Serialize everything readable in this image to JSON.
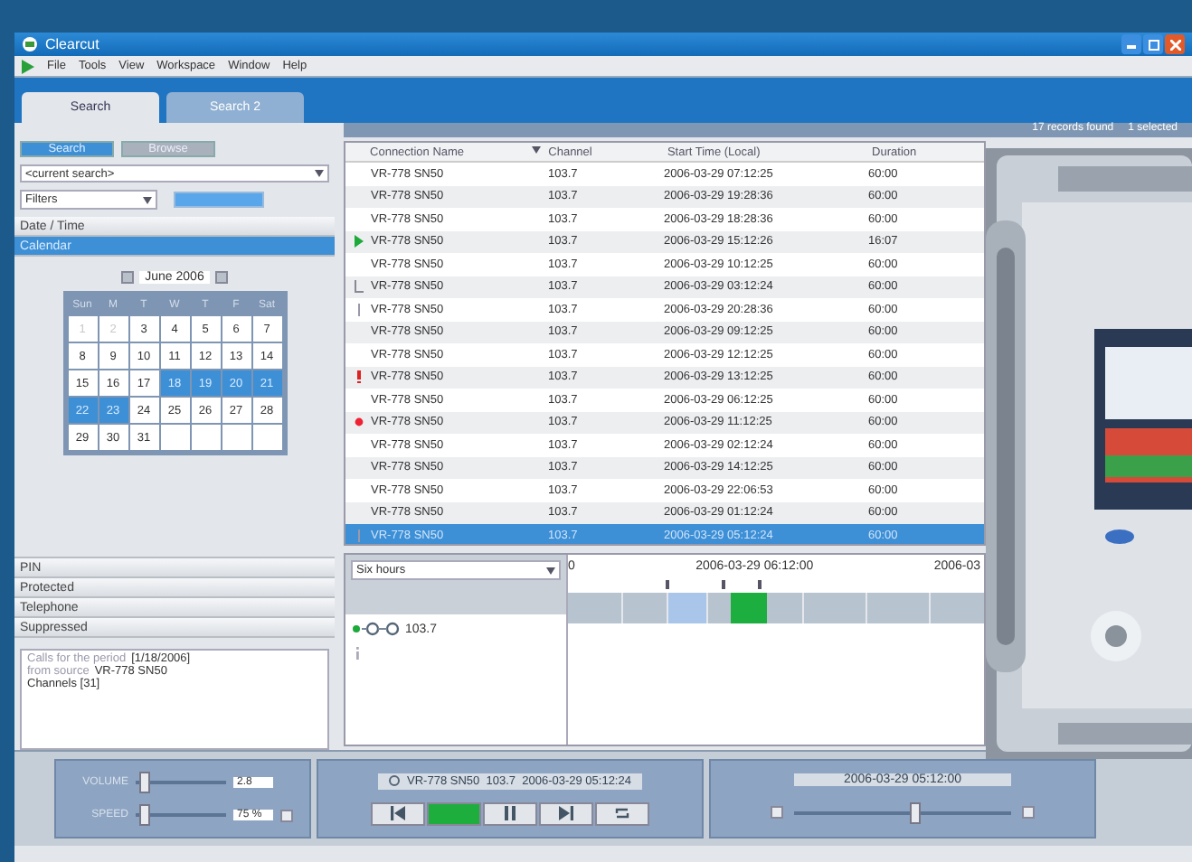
{
  "window": {
    "title": "Clearcut"
  },
  "menu": [
    "File",
    "Tools",
    "View",
    "Workspace",
    "Window",
    "Help"
  ],
  "tabs": [
    {
      "label": "Search",
      "selected": true
    },
    {
      "label": "Search 2",
      "selected": false
    }
  ],
  "left_panel": {
    "modes": [
      {
        "label": "Search",
        "selected": true
      },
      {
        "label": "Browse",
        "selected": false
      }
    ],
    "search_combo": {
      "value": "<current search>"
    },
    "filters_combo": {
      "value": "Filters"
    },
    "sections_top": [
      {
        "label": "Date / Time",
        "selected": false
      },
      {
        "label": "Calendar",
        "selected": true
      }
    ],
    "calendar": {
      "month": "June 2006",
      "weekdays": [
        "Sun",
        "M",
        "T",
        "W",
        "T",
        "F",
        "Sat"
      ],
      "days": [
        {
          "text": "1",
          "muted": true,
          "selected": false
        },
        {
          "text": "2",
          "muted": true,
          "selected": false
        },
        {
          "text": "3",
          "muted": false,
          "selected": false
        },
        {
          "text": "4",
          "muted": false,
          "selected": false
        },
        {
          "text": "5",
          "muted": false,
          "selected": false
        },
        {
          "text": "6",
          "muted": false,
          "selected": false
        },
        {
          "text": "7",
          "muted": false,
          "selected": false
        },
        {
          "text": "8",
          "muted": false,
          "selected": false
        },
        {
          "text": "9",
          "muted": false,
          "selected": false
        },
        {
          "text": "10",
          "muted": false,
          "selected": false
        },
        {
          "text": "11",
          "muted": false,
          "selected": false
        },
        {
          "text": "12",
          "muted": false,
          "selected": false
        },
        {
          "text": "13",
          "muted": false,
          "selected": false
        },
        {
          "text": "14",
          "muted": false,
          "selected": false
        },
        {
          "text": "15",
          "muted": false,
          "selected": false
        },
        {
          "text": "16",
          "muted": false,
          "selected": false
        },
        {
          "text": "17",
          "muted": false,
          "selected": false
        },
        {
          "text": "18",
          "muted": false,
          "selected": true
        },
        {
          "text": "19",
          "muted": false,
          "selected": true
        },
        {
          "text": "20",
          "muted": false,
          "selected": true
        },
        {
          "text": "21",
          "muted": false,
          "selected": true
        },
        {
          "text": "22",
          "muted": false,
          "selected": true
        },
        {
          "text": "23",
          "muted": false,
          "selected": true
        },
        {
          "text": "24",
          "muted": false,
          "selected": false
        },
        {
          "text": "25",
          "muted": false,
          "selected": false
        },
        {
          "text": "26",
          "muted": false,
          "selected": false
        },
        {
          "text": "27",
          "muted": false,
          "selected": false
        },
        {
          "text": "28",
          "muted": false,
          "selected": false
        },
        {
          "text": "29",
          "muted": false,
          "selected": false
        },
        {
          "text": "30",
          "muted": false,
          "selected": false
        },
        {
          "text": "31",
          "muted": false,
          "selected": false
        }
      ]
    },
    "sections_bottom": [
      "PIN",
      "Protected",
      "Telephone",
      "Suppressed"
    ],
    "info_lines": [
      {
        "label": "Calls for the period",
        "value": "[1/18/2006]"
      },
      {
        "label": "from source",
        "value": "VR-778 SN50"
      },
      {
        "value": "Channels [31]"
      }
    ]
  },
  "status_top": {
    "found": "17 records found",
    "selected": "1 selected"
  },
  "table": {
    "columns": [
      "Connection Name",
      "Channel",
      "Start Time (Local)",
      "Duration"
    ],
    "rows": [
      {
        "kind": "plain",
        "cells": [
          "VR-778 SN50",
          "103.7",
          "2006-03-29 07:12:25",
          "60:00"
        ],
        "selected": false
      },
      {
        "kind": "plain",
        "cells": [
          "VR-778 SN50",
          "103.7",
          "2006-03-29 19:28:36",
          "60:00"
        ],
        "selected": false
      },
      {
        "kind": "plain",
        "cells": [
          "VR-778 SN50",
          "103.7",
          "2006-03-29 18:28:36",
          "60:00"
        ],
        "selected": false
      },
      {
        "kind": "playing",
        "cells": [
          "VR-778 SN50",
          "103.7",
          "2006-03-29 15:12:26",
          "16:07"
        ],
        "selected": false
      },
      {
        "kind": "plain",
        "cells": [
          "VR-778 SN50",
          "103.7",
          "2006-03-29 10:12:25",
          "60:00"
        ],
        "selected": false
      },
      {
        "kind": "bracketed",
        "cells": [
          "VR-778 SN50",
          "103.7",
          "2006-03-29 03:12:24",
          "60:00"
        ],
        "selected": false
      },
      {
        "kind": "marked",
        "cells": [
          "VR-778 SN50",
          "103.7",
          "2006-03-29 20:28:36",
          "60:00"
        ],
        "selected": false
      },
      {
        "kind": "plain",
        "cells": [
          "VR-778 SN50",
          "103.7",
          "2006-03-29 09:12:25",
          "60:00"
        ],
        "selected": false
      },
      {
        "kind": "plain",
        "cells": [
          "VR-778 SN50",
          "103.7",
          "2006-03-29 12:12:25",
          "60:00"
        ],
        "selected": false
      },
      {
        "kind": "alert",
        "cells": [
          "VR-778 SN50",
          "103.7",
          "2006-03-29 13:12:25",
          "60:00"
        ],
        "selected": false
      },
      {
        "kind": "plain",
        "cells": [
          "VR-778 SN50",
          "103.7",
          "2006-03-29 06:12:25",
          "60:00"
        ],
        "selected": false
      },
      {
        "kind": "recording",
        "cells": [
          "VR-778 SN50",
          "103.7",
          "2006-03-29 11:12:25",
          "60:00"
        ],
        "selected": false
      },
      {
        "kind": "plain",
        "cells": [
          "VR-778 SN50",
          "103.7",
          "2006-03-29 02:12:24",
          "60:00"
        ],
        "selected": false
      },
      {
        "kind": "plain",
        "cells": [
          "VR-778 SN50",
          "103.7",
          "2006-03-29 14:12:25",
          "60:00"
        ],
        "selected": false
      },
      {
        "kind": "plain",
        "cells": [
          "VR-778 SN50",
          "103.7",
          "2006-03-29 22:06:53",
          "60:00"
        ],
        "selected": false
      },
      {
        "kind": "plain",
        "cells": [
          "VR-778 SN50",
          "103.7",
          "2006-03-29 01:12:24",
          "60:00"
        ],
        "selected": false
      },
      {
        "kind": "marked",
        "cells": [
          "VR-778 SN50",
          "103.7",
          "2006-03-29 05:12:24",
          "60:00"
        ],
        "selected": true
      }
    ]
  },
  "timeline": {
    "range": "Six hours",
    "ruler": [
      "0",
      "2006-03-29 06:12:00",
      "2006-03"
    ],
    "channels": [
      {
        "label": "103.7"
      }
    ]
  },
  "player": {
    "volume": {
      "label": "VOLUME",
      "level": 0.05,
      "reading": "2.8"
    },
    "speed": {
      "label": "SPEED",
      "level": 0.05,
      "reading": "75 %"
    },
    "now_playing": "VR-778 SN50  103.7  2006-03-29 05:12:24",
    "transport": [
      {
        "kind": "previous",
        "selected": false
      },
      {
        "kind": "play",
        "selected": true
      },
      {
        "kind": "pause",
        "selected": false
      },
      {
        "kind": "next",
        "selected": false
      },
      {
        "kind": "loop",
        "selected": false
      }
    ],
    "position": {
      "time": "2006-03-29 05:12:00",
      "level": 0.55
    }
  }
}
